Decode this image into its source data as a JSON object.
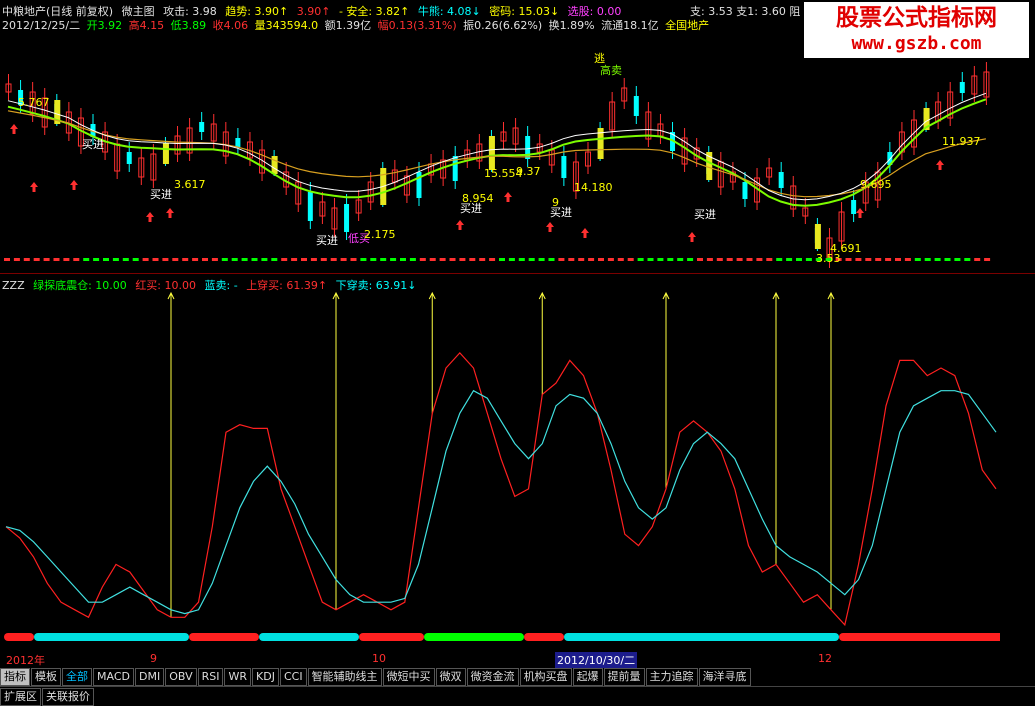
{
  "header": {
    "stock": "中粮地产(日线 前复权)",
    "indicator": "微主图",
    "attack": "攻击: 3.98",
    "trend": "趋势: 3.90↑",
    "trend2": "3.90↑",
    "safe": "- 安全: 3.82↑",
    "bull": "牛熊: 4.08↓",
    "secret": "密码: 15.03↓",
    "pick": "选股: 0.00",
    "support": "支: 3.53",
    "support1": "支1: 3.60",
    "resist": "阻"
  },
  "quote": {
    "date": "2012/12/25/二",
    "open": "开3.92",
    "high": "高4.15",
    "low": "低3.89",
    "close": "收4.06",
    "volume": "量343594.0",
    "amount": "额1.39亿",
    "change": "幅0.13(3.31%)",
    "amplitude": "振0.26(6.62%)",
    "turnover": "换1.89%",
    "float": "流通18.1亿",
    "sector": "全国地产"
  },
  "watermark": {
    "line1": "股票公式指标网",
    "line2": "www.gszb.com"
  },
  "main_annotations": [
    {
      "text": "5.767"
    },
    {
      "text": "买进"
    },
    {
      "text": "3.617"
    },
    {
      "text": "买进"
    },
    {
      "text": "买进"
    },
    {
      "text": "低买"
    },
    {
      "text": "2.175"
    },
    {
      "text": "8.954"
    },
    {
      "text": "买进"
    },
    {
      "text": "15.554"
    },
    {
      "text": "9.37"
    },
    {
      "text": "9"
    },
    {
      "text": "买进"
    },
    {
      "text": "14.180"
    },
    {
      "text": "逃"
    },
    {
      "text": "高卖"
    },
    {
      "text": "买进"
    },
    {
      "text": "4.691"
    },
    {
      "text": "3.53"
    },
    {
      "text": "9.695"
    },
    {
      "text": "11.937"
    }
  ],
  "indicator": {
    "name": "ZZZ",
    "green": "绿探底震仓: 10.00",
    "red": "红买: 10.00",
    "blue": "蓝卖: -",
    "upcross": "上穿买: 61.39↑",
    "downcross": "下穿卖: 63.91↓"
  },
  "chart_data": {
    "type": "line",
    "title": "",
    "series": [
      {
        "name": "上穿买",
        "color": "#ff2020",
        "values": [
          30,
          27,
          22,
          15,
          10,
          8,
          6,
          14,
          20,
          18,
          13,
          8,
          6,
          6,
          10,
          30,
          55,
          57,
          56,
          56,
          40,
          30,
          20,
          10,
          8,
          10,
          12,
          10,
          8,
          10,
          35,
          60,
          72,
          76,
          72,
          60,
          48,
          38,
          40,
          65,
          68,
          74,
          70,
          60,
          45,
          28,
          25,
          30,
          40,
          55,
          58,
          55,
          50,
          40,
          25,
          18,
          20,
          15,
          10,
          12,
          8,
          4,
          20,
          40,
          62,
          74,
          74,
          70,
          72,
          70,
          60,
          45,
          40
        ]
      },
      {
        "name": "下穿卖",
        "color": "#40e0e0",
        "values": [
          30,
          29,
          26,
          22,
          18,
          14,
          10,
          10,
          12,
          14,
          12,
          10,
          8,
          7,
          8,
          15,
          25,
          35,
          42,
          46,
          42,
          36,
          28,
          22,
          16,
          12,
          10,
          10,
          10,
          11,
          20,
          35,
          50,
          60,
          66,
          64,
          58,
          52,
          48,
          52,
          62,
          65,
          64,
          60,
          52,
          42,
          35,
          32,
          35,
          45,
          52,
          55,
          52,
          48,
          40,
          32,
          25,
          22,
          20,
          18,
          15,
          12,
          16,
          25,
          40,
          55,
          62,
          64,
          66,
          66,
          65,
          60,
          55
        ]
      }
    ],
    "signals_index": [
      12,
      24,
      31,
      39,
      48,
      56,
      60
    ],
    "ylim": [
      0,
      90
    ],
    "xlabels": [
      "2012年",
      "9",
      "10",
      "2012/10/30/二",
      "12"
    ]
  },
  "tabs": [
    "指标",
    "模板",
    "全部",
    "MACD",
    "DMI",
    "OBV",
    "RSI",
    "WR",
    "KDJ",
    "CCI",
    "智能辅助线主",
    "微短中买",
    "微双",
    "微资金流",
    "机构买盘",
    "起爆",
    "提前量",
    "主力追踪",
    "海洋寻底"
  ],
  "bottom_tabs": [
    "扩展区",
    "关联报价"
  ],
  "colors": {
    "up": "#ff3030",
    "down": "#00ffff",
    "ma_green": "#7cfc00",
    "ma_gold": "#d8a020",
    "ma_white": "#ffffff"
  }
}
